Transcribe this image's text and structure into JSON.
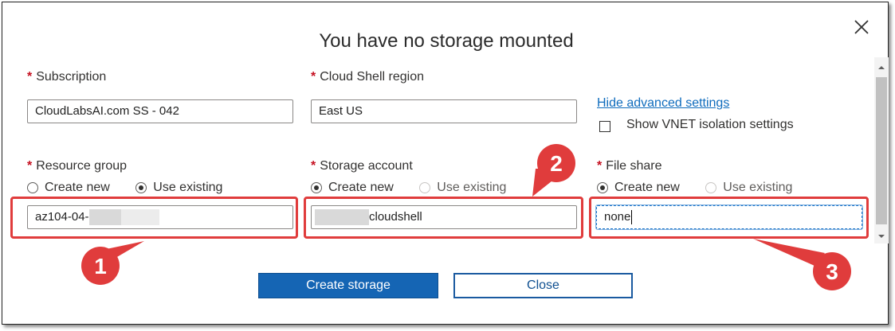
{
  "dialog": {
    "title": "You have no storage mounted",
    "close_icon": "close-icon"
  },
  "subscription": {
    "required_mark": "*",
    "label": "Subscription",
    "value": "CloudLabsAI.com SS - 042"
  },
  "region": {
    "required_mark": "*",
    "label": "Cloud Shell region",
    "value": "East US"
  },
  "advanced": {
    "link": "Hide advanced settings",
    "vnet_label": "Show VNET isolation settings",
    "vnet_checked": false
  },
  "resource_group": {
    "required_mark": "*",
    "label": "Resource group",
    "options": [
      "Create new",
      "Use existing"
    ],
    "selected": "Use existing",
    "value_prefix": "az104-04-"
  },
  "storage_account": {
    "required_mark": "*",
    "label": "Storage account",
    "options": [
      "Create new",
      "Use existing"
    ],
    "selected": "Create new",
    "value_suffix": "cloudshell"
  },
  "file_share": {
    "required_mark": "*",
    "label": "File share",
    "options": [
      "Create new",
      "Use existing"
    ],
    "selected": "Create new",
    "value": "none"
  },
  "buttons": {
    "create": "Create storage",
    "close": "Close"
  },
  "annotations": {
    "marker_1": "1",
    "marker_2": "2",
    "marker_3": "3",
    "color": "#e03c3c"
  },
  "colors": {
    "primary_button": "#1565b4",
    "link": "#0f6cbd",
    "required": "#c50f1f"
  }
}
